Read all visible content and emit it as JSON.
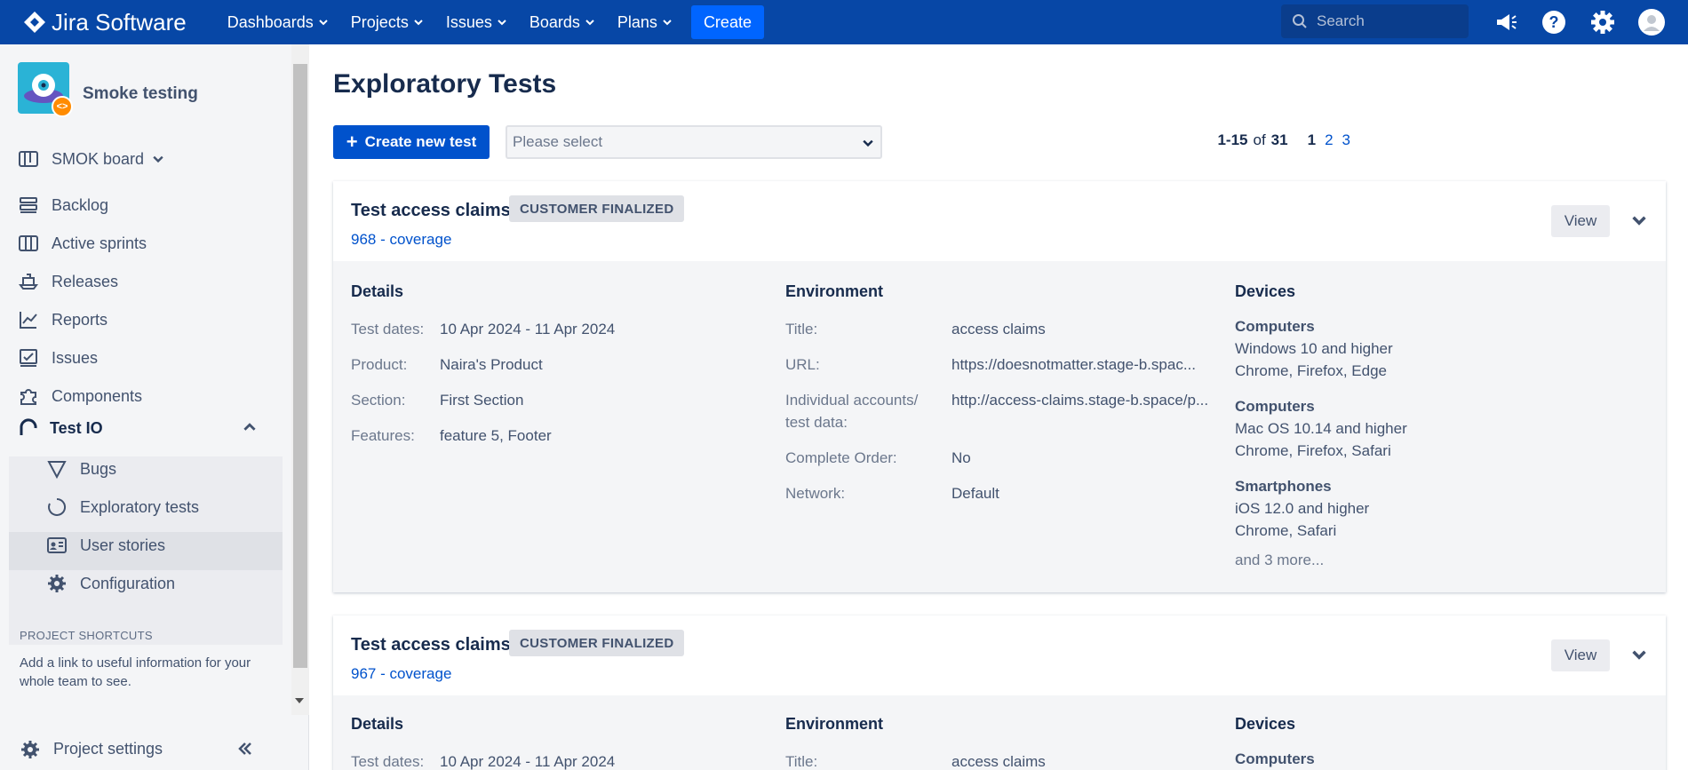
{
  "topnav": {
    "logo": "Jira Software",
    "items": [
      "Dashboards",
      "Projects",
      "Issues",
      "Boards",
      "Plans"
    ],
    "create": "Create",
    "search_placeholder": "Search"
  },
  "sidebar": {
    "project_name": "Smoke testing",
    "board": "SMOK board",
    "items": [
      "Backlog",
      "Active sprints",
      "Releases",
      "Reports",
      "Issues",
      "Components"
    ],
    "testio": {
      "label": "Test IO",
      "items": [
        "Bugs",
        "Exploratory tests",
        "User stories",
        "Configuration"
      ]
    },
    "shortcuts_title": "PROJECT SHORTCUTS",
    "shortcuts_text": "Add a link to useful information for your whole team to see.",
    "project_settings": "Project settings"
  },
  "main": {
    "title": "Exploratory Tests",
    "create_button": "Create new test",
    "select_placeholder": "Please select",
    "pager": {
      "range": "1-15",
      "of": "of",
      "total": "31",
      "pages": [
        "1",
        "2",
        "3"
      ]
    }
  },
  "cards": [
    {
      "title": "Test access claims",
      "badge": "CUSTOMER FINALIZED",
      "link": "968 - coverage",
      "view": "View",
      "details_heading": "Details",
      "details": [
        {
          "label": "Test dates:",
          "value": "10 Apr 2024 - 11 Apr 2024"
        },
        {
          "label": "Product:",
          "value": "Naira's Product"
        },
        {
          "label": "Section:",
          "value": "First Section"
        },
        {
          "label": "Features:",
          "value": "feature 5, Footer"
        }
      ],
      "env_heading": "Environment",
      "env": [
        {
          "label": "Title:",
          "value": "access claims"
        },
        {
          "label": "URL:",
          "value": "https://doesnotmatter.stage-b.spac..."
        },
        {
          "label": "Individual accounts/ test data:",
          "value": "http://access-claims.stage-b.space/p..."
        },
        {
          "label": "Complete Order:",
          "value": "No"
        },
        {
          "label": "Network:",
          "value": "Default"
        }
      ],
      "devices_heading": "Devices",
      "devices": [
        {
          "category": "Computers",
          "os": "Windows 10 and higher",
          "browsers": "Chrome, Firefox, Edge"
        },
        {
          "category": "Computers",
          "os": "Mac OS 10.14 and higher",
          "browsers": "Chrome, Firefox, Safari"
        },
        {
          "category": "Smartphones",
          "os": "iOS 12.0 and higher",
          "browsers": "Chrome, Safari"
        }
      ],
      "more": "and 3 more..."
    },
    {
      "title": "Test access claims",
      "badge": "CUSTOMER FINALIZED",
      "link": "967 - coverage",
      "view": "View",
      "details_heading": "Details",
      "details": [
        {
          "label": "Test dates:",
          "value": "10 Apr 2024 - 11 Apr 2024"
        }
      ],
      "env_heading": "Environment",
      "env": [
        {
          "label": "Title:",
          "value": "access claims"
        }
      ],
      "devices_heading": "Devices",
      "devices": [
        {
          "category": "Computers"
        }
      ]
    }
  ]
}
